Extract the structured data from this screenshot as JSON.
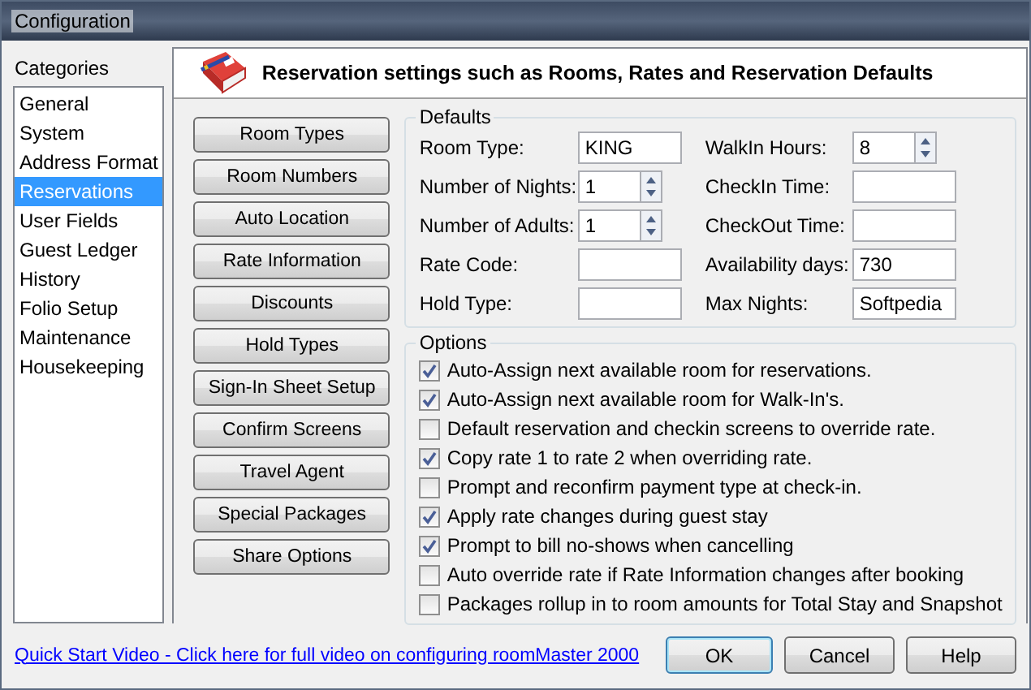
{
  "window": {
    "title": "Configuration"
  },
  "sidebar": {
    "title": "Categories",
    "items": [
      {
        "label": "General",
        "selected": false
      },
      {
        "label": "System",
        "selected": false
      },
      {
        "label": "Address Format",
        "selected": false
      },
      {
        "label": "Reservations",
        "selected": true
      },
      {
        "label": "User Fields",
        "selected": false
      },
      {
        "label": "Guest Ledger",
        "selected": false
      },
      {
        "label": "History",
        "selected": false
      },
      {
        "label": "Folio Setup",
        "selected": false
      },
      {
        "label": "Maintenance",
        "selected": false
      },
      {
        "label": "Housekeeping",
        "selected": false
      }
    ]
  },
  "header": {
    "title": "Reservation settings such as Rooms, Rates and Reservation Defaults"
  },
  "side_buttons": [
    "Room Types",
    "Room Numbers",
    "Auto Location",
    "Rate Information",
    "Discounts",
    "Hold Types",
    "Sign-In Sheet Setup",
    "Confirm Screens",
    "Travel Agent",
    "Special Packages",
    "Share Options"
  ],
  "defaults": {
    "title": "Defaults",
    "columns": [
      [
        {
          "label": "Room Type:",
          "kind": "text",
          "value": "KING"
        },
        {
          "label": "Number of Nights:",
          "kind": "spinner",
          "value": "1"
        },
        {
          "label": "Number of Adults:",
          "kind": "spinner",
          "value": "1"
        },
        {
          "label": "Rate Code:",
          "kind": "text"
        },
        {
          "label": "Hold Type:",
          "kind": "text"
        }
      ],
      [
        {
          "label": "WalkIn Hours:",
          "kind": "spinner",
          "value": "8"
        },
        {
          "label": "CheckIn Time:",
          "kind": "text"
        },
        {
          "label": "CheckOut Time:",
          "kind": "text"
        },
        {
          "label": "Availability days:",
          "kind": "text",
          "value": "730"
        },
        {
          "label": "Max Nights:",
          "kind": "text",
          "value": "Softpedia"
        }
      ]
    ]
  },
  "options": {
    "title": "Options",
    "items": [
      {
        "label": "Auto-Assign next available room for reservations.",
        "checked": true
      },
      {
        "label": "Auto-Assign next available room for Walk-In's.",
        "checked": true
      },
      {
        "label": "Default reservation and checkin screens to override rate.",
        "checked": false
      },
      {
        "label": "Copy rate 1 to rate 2 when overriding rate.",
        "checked": true
      },
      {
        "label": "Prompt and reconfirm payment type at check-in.",
        "checked": false
      },
      {
        "label": "Apply rate changes during guest stay",
        "checked": true
      },
      {
        "label": "Prompt to bill no-shows when cancelling",
        "checked": true
      },
      {
        "label": "Auto override rate if Rate Information changes after booking",
        "checked": false
      },
      {
        "label": "Packages rollup in to room amounts for Total Stay and Snapshot",
        "checked": false
      }
    ]
  },
  "footer": {
    "link": "Quick Start Video - Click here for full video on configuring roomMaster 2000",
    "buttons": [
      {
        "label": "OK",
        "default": true
      },
      {
        "label": "Cancel",
        "default": false
      },
      {
        "label": "Help",
        "default": false
      }
    ]
  }
}
